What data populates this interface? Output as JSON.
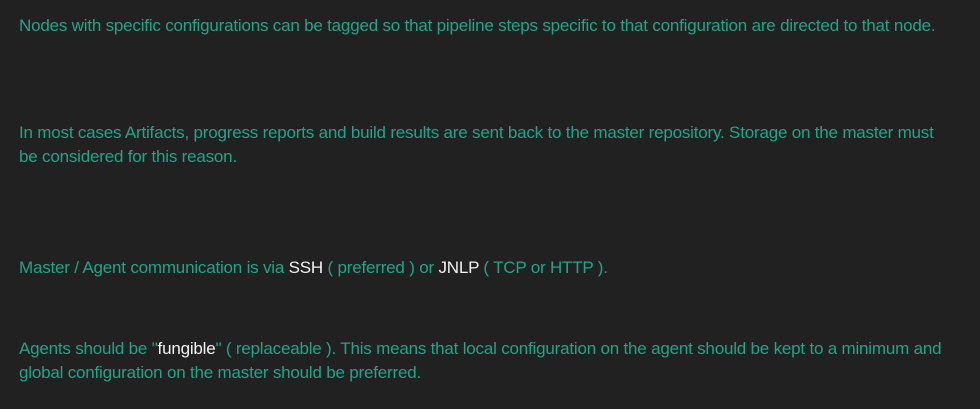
{
  "colors": {
    "background": "#212121",
    "text_accent": "#1fa58a",
    "text_highlight": "#f2f2f2"
  },
  "paragraphs": {
    "p1": {
      "text": "Nodes with specific configurations can be tagged so that pipeline steps specific to that configuration are directed to that node."
    },
    "p2": {
      "text": "In most cases Artifacts, progress reports and build results are sent back to the master repository. Storage on the master must be considered for this reason."
    },
    "p3": {
      "part1": "Master / Agent communication is via ",
      "highlight1": "SSH",
      "part2": " ( preferred ) or ",
      "highlight2": "JNLP",
      "part3": " ( TCP or HTTP )."
    },
    "p4": {
      "part1": "Agents should be \"",
      "highlight1": "fungible",
      "part2": "\" ( replaceable ). This means that local configuration on the agent should be kept to a minimum and global configuration on the master should be preferred."
    }
  }
}
